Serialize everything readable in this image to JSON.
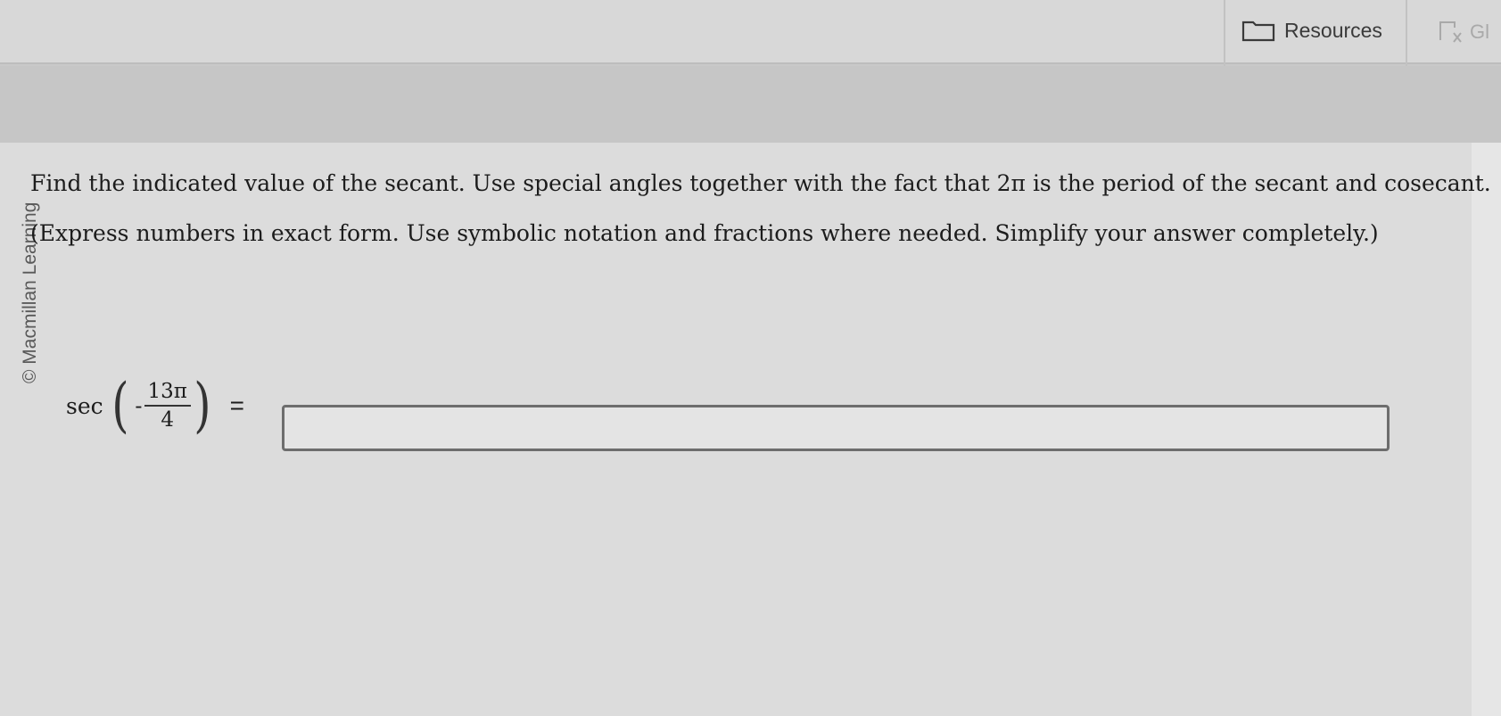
{
  "toolbar": {
    "resources_label": "Resources",
    "glossary_label": "Gl"
  },
  "credit": {
    "text": "© Macmillan Learning"
  },
  "question": {
    "line1": "Find the indicated value of the secant. Use special angles together with the fact that 2π is the period of the secant and cosecant.",
    "line2": "(Express numbers in exact form. Use symbolic notation and fractions where needed. Simplify your answer completely.)"
  },
  "expression": {
    "function": "sec",
    "sign": "-",
    "numerator": "13π",
    "denominator": "4",
    "equals": "="
  },
  "answer": {
    "value": "",
    "placeholder": ""
  },
  "icons": {
    "resources": "folder-icon",
    "glossary": "glossary-icon"
  }
}
